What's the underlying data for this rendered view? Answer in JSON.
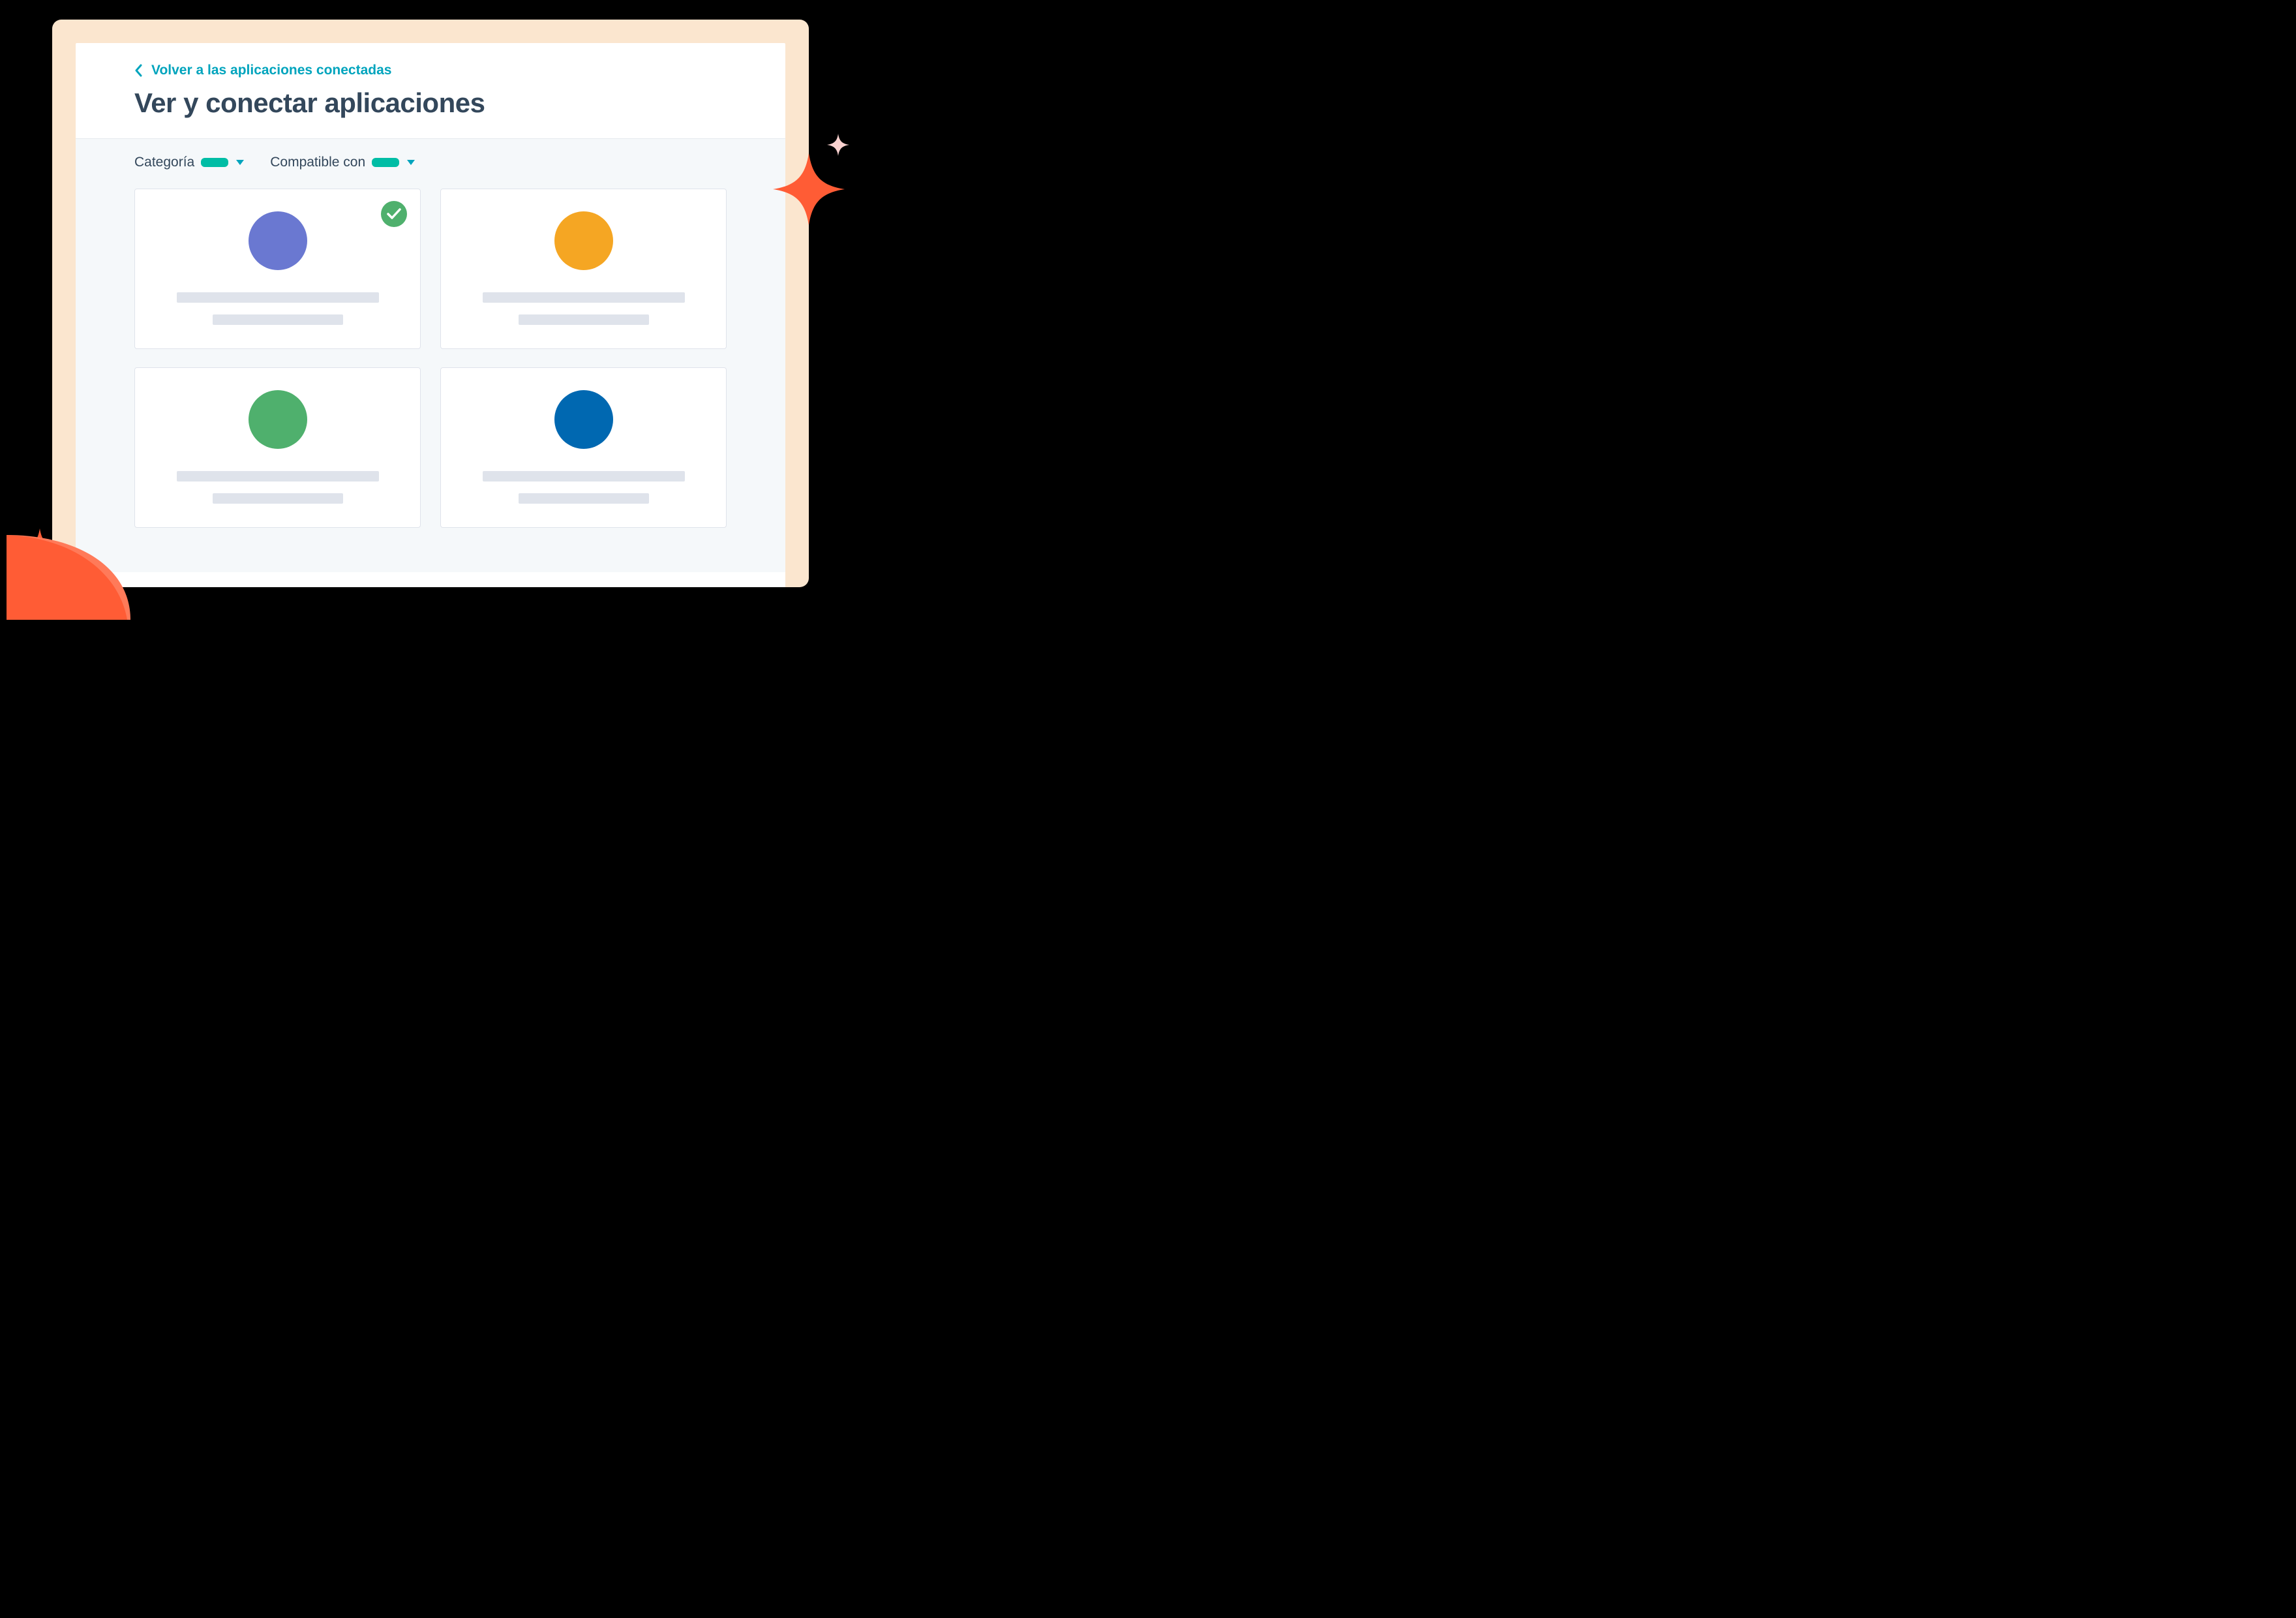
{
  "header": {
    "back_label": "Volver a las aplicaciones conectadas",
    "title": "Ver y conectar aplicaciones"
  },
  "filters": {
    "category_label": "Categoría",
    "compatible_label": "Compatible con"
  },
  "colors": {
    "teal": "#00a4bd",
    "teal_pill": "#00bda5",
    "text": "#33475b",
    "badge_green": "#4fb06d",
    "spark_orange": "#ff5c35",
    "spark_pink": "#f5c2c7"
  },
  "apps": [
    {
      "color": "#6a78d1",
      "connected": true
    },
    {
      "color": "#f5a623",
      "connected": false
    },
    {
      "color": "#4fb06d",
      "connected": false
    },
    {
      "color": "#0068b1",
      "connected": false
    }
  ]
}
